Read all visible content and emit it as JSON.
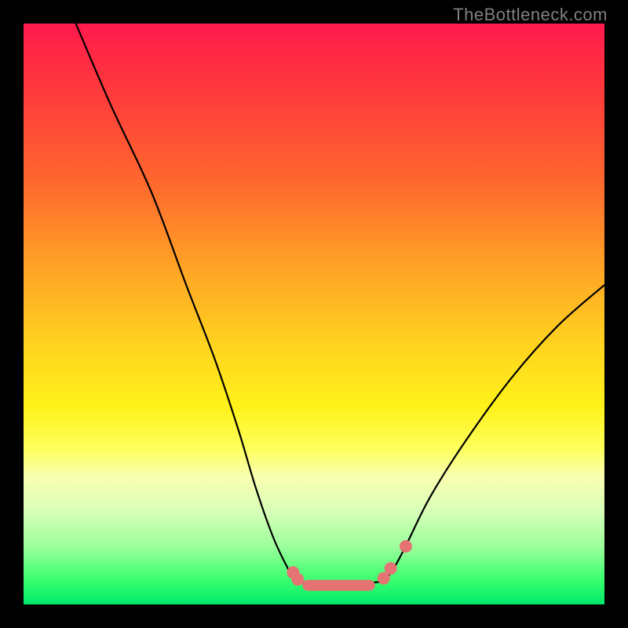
{
  "watermark": "TheBottleneck.com",
  "chart_data": {
    "type": "line",
    "title": "",
    "xlabel": "",
    "ylabel": "",
    "xlim": [
      0,
      100
    ],
    "ylim": [
      0,
      100
    ],
    "series": [
      {
        "name": "left-branch",
        "x": [
          9,
          15,
          22,
          28,
          33,
          37,
          40,
          43,
          45.5,
          46.5,
          47.3
        ],
        "y": [
          100,
          86,
          71,
          55,
          42,
          30,
          20,
          11.5,
          6.2,
          4.6,
          3.9
        ]
      },
      {
        "name": "right-branch",
        "x": [
          61.5,
          62.5,
          63.8,
          66,
          70,
          76,
          84,
          92,
          100
        ],
        "y": [
          3.9,
          4.6,
          6.3,
          10.5,
          18.5,
          28,
          39,
          48,
          55
        ]
      }
    ],
    "flat_bottom": {
      "x_start": 47.3,
      "x_end": 61.5,
      "y": 3.3
    },
    "markers": [
      {
        "x": 46.4,
        "y": 5.5
      },
      {
        "x": 47.2,
        "y": 4.3
      },
      {
        "x": 62.0,
        "y": 4.5
      },
      {
        "x": 63.2,
        "y": 6.2
      },
      {
        "x": 65.8,
        "y": 10.0
      }
    ],
    "bottom_bar_markers": {
      "x_start": 48.0,
      "x_end": 60.5,
      "y": 3.3
    },
    "colors": {
      "curve": "#000000",
      "marker_fill": "#e57373",
      "marker_stroke": "#e57373"
    }
  }
}
